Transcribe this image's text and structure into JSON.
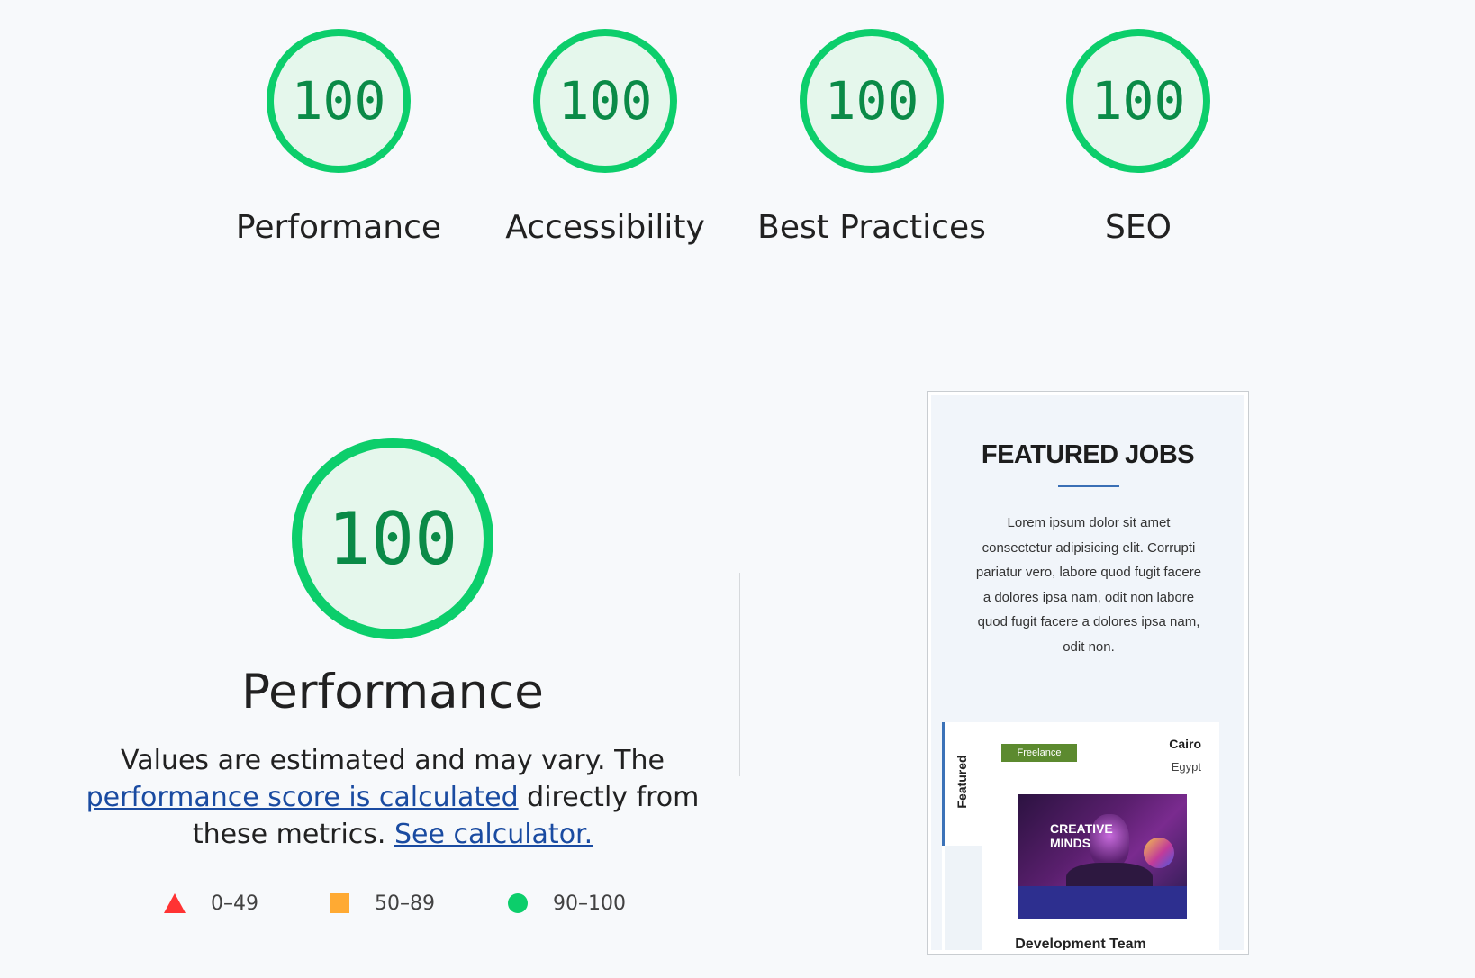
{
  "categories": [
    {
      "score": "100",
      "label": "Performance"
    },
    {
      "score": "100",
      "label": "Accessibility"
    },
    {
      "score": "100",
      "label": "Best Practices"
    },
    {
      "score": "100",
      "label": "SEO"
    }
  ],
  "performance": {
    "score": "100",
    "title": "Performance",
    "desc_prefix": "Values are estimated and may vary. The",
    "link_score": "performance score is calculated",
    "desc_middle": "directly from these metrics.",
    "link_calculator": "See calculator."
  },
  "legend": [
    {
      "shape": "triangle",
      "range": "0–49",
      "color": "#ff3333"
    },
    {
      "shape": "square",
      "range": "50–89",
      "color": "#ffaa33"
    },
    {
      "shape": "circle",
      "range": "90–100",
      "color": "#0cce6b"
    }
  ],
  "screenshot": {
    "heading": "FEATURED JOBS",
    "body": "Lorem ipsum dolor sit amet consectetur adipisicing elit. Corrupti pariatur vero, labore quod fugit facere a dolores ipsa nam, odit non labore quod fugit facere a dolores ipsa nam, odit non.",
    "featured": "Featured",
    "badge": "Freelance",
    "city": "Cairo",
    "country": "Egypt",
    "image_text_1": "CREATIVE",
    "image_text_2": "MINDS",
    "job_title": "Development Team"
  },
  "colors": {
    "pass": "#0cce6b",
    "pass_bg": "#e5f7ec",
    "link": "#1a4ba1"
  }
}
